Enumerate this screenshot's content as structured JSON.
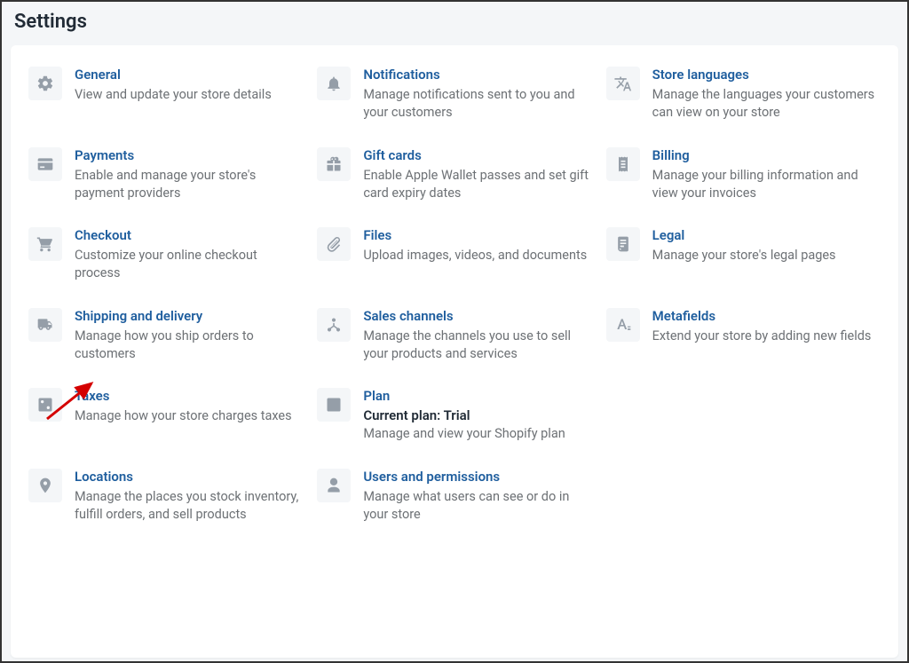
{
  "page": {
    "title": "Settings"
  },
  "items": {
    "general": {
      "title": "General",
      "desc": "View and update your store details"
    },
    "payments": {
      "title": "Payments",
      "desc": "Enable and manage your store's payment providers"
    },
    "checkout": {
      "title": "Checkout",
      "desc": "Customize your online checkout process"
    },
    "shipping": {
      "title": "Shipping and delivery",
      "desc": "Manage how you ship orders to customers"
    },
    "taxes": {
      "title": "Taxes",
      "desc": "Manage how your store charges taxes"
    },
    "locations": {
      "title": "Locations",
      "desc": "Manage the places you stock inventory, fulfill orders, and sell products"
    },
    "notifications": {
      "title": "Notifications",
      "desc": "Manage notifications sent to you and your customers"
    },
    "giftcards": {
      "title": "Gift cards",
      "desc": "Enable Apple Wallet passes and set gift card expiry dates"
    },
    "files": {
      "title": "Files",
      "desc": "Upload images, videos, and documents"
    },
    "sales": {
      "title": "Sales channels",
      "desc": "Manage the channels you use to sell your products and services"
    },
    "plan": {
      "title": "Plan",
      "sub": "Current plan: Trial",
      "desc": "Manage and view your Shopify plan"
    },
    "users": {
      "title": "Users and permissions",
      "desc": "Manage what users can see or do in your store"
    },
    "languages": {
      "title": "Store languages",
      "desc": "Manage the languages your customers can view on your store"
    },
    "billing": {
      "title": "Billing",
      "desc": "Manage your billing information and view your invoices"
    },
    "legal": {
      "title": "Legal",
      "desc": "Manage your store's legal pages"
    },
    "metafields": {
      "title": "Metafields",
      "desc": "Extend your store by adding new fields"
    }
  }
}
